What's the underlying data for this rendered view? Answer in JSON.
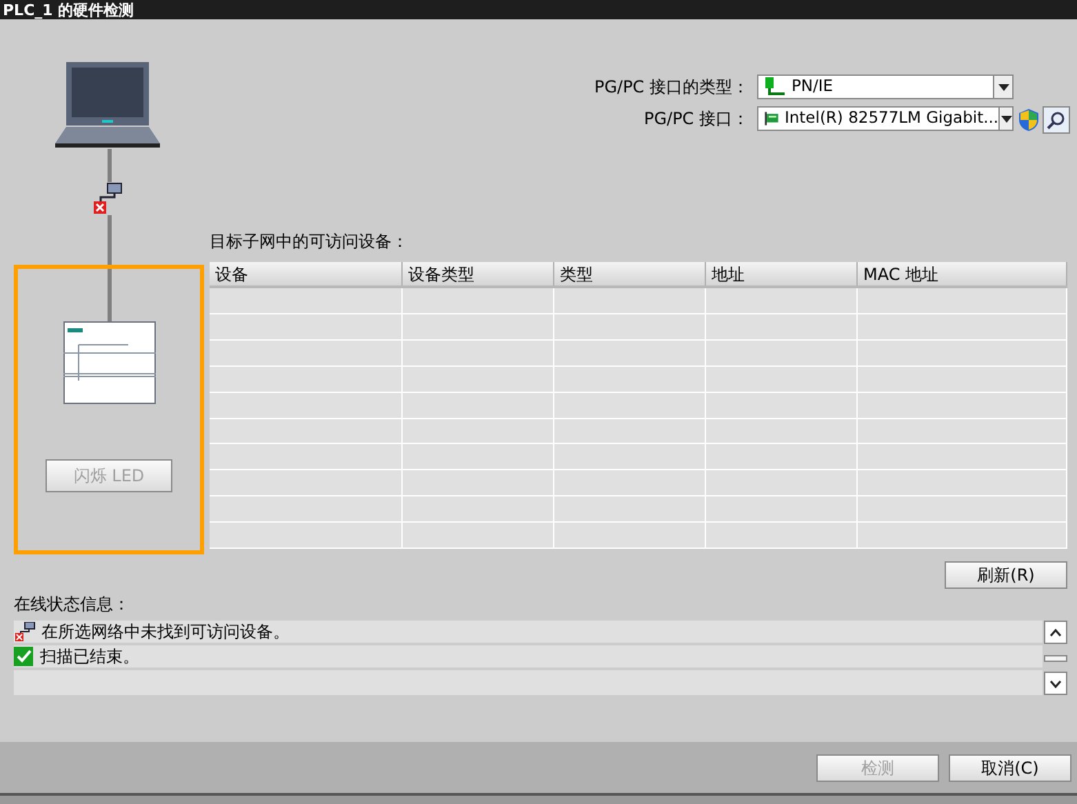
{
  "window": {
    "title": "PLC_1 的硬件检测"
  },
  "interface_type": {
    "label": "PG/PC 接口的类型：",
    "value": "PN/IE"
  },
  "interface": {
    "label": "PG/PC 接口：",
    "value": "Intel(R) 82577LM Gigabit..."
  },
  "devices_table": {
    "title": "目标子网中的可访问设备：",
    "columns": [
      "设备",
      "设备类型",
      "类型",
      "地址",
      "MAC 地址"
    ]
  },
  "flash_led": {
    "label": "闪烁 LED",
    "disabled": true
  },
  "refresh": {
    "label": "刷新(R)",
    "disabled": false
  },
  "status": {
    "label": "在线状态信息：",
    "messages": [
      {
        "kind": "error",
        "text": "在所选网络中未找到可访问设备。"
      },
      {
        "kind": "ok",
        "text": "扫描已结束。"
      }
    ]
  },
  "footer_buttons": [
    {
      "label": "检测",
      "disabled": true
    },
    {
      "label": "取消(C)",
      "disabled": false
    }
  ]
}
